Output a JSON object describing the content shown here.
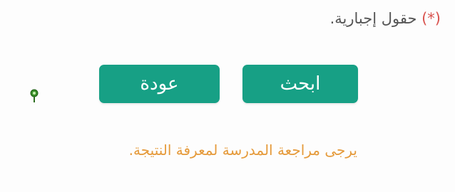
{
  "form": {
    "required_fields_note": "حقول إجبارية.",
    "required_marker": "(*)"
  },
  "actions": {
    "search_label": "ابحث",
    "back_label": "عودة"
  },
  "message": {
    "text": "يرجى مراجعة المدرسة لمعرفة النتيجة."
  },
  "colors": {
    "button_bg": "#17a085",
    "message_text": "#e59a3a",
    "note_text": "#555555"
  },
  "icons": {
    "pin": "map-pin-icon"
  }
}
